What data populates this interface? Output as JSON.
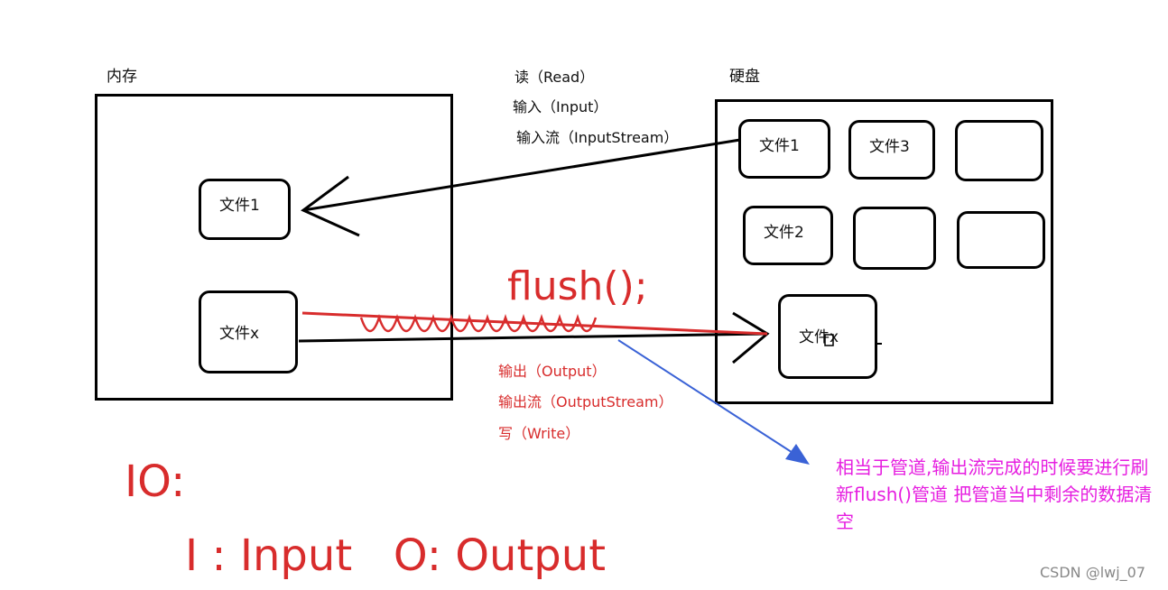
{
  "memory": {
    "title": "内存"
  },
  "disk": {
    "title": "硬盘"
  },
  "mem_files": {
    "file1": "文件1",
    "filex": "文件x"
  },
  "disk_files": {
    "file1": "文件1",
    "file3": "文件3",
    "file2": "文件2",
    "filex": "文件x"
  },
  "read_labels": {
    "read": "读（Read）",
    "input": "输入（Input）",
    "input_stream": "输入流（InputStream）"
  },
  "write_labels": {
    "output": "输出（Output）",
    "output_stream": "输出流（OutputStream）",
    "write": "写（Write）"
  },
  "flush_label": "flush();",
  "io": {
    "title": "IO:",
    "meaning": "I : Input   O: Output"
  },
  "note": "相当于管道,输出流完成的时候要进行刷新flush()管道 把管道当中剩余的数据清空",
  "watermark": "CSDN @lwj_07",
  "colors": {
    "red": "#d82c2c",
    "magenta": "#e61ee0",
    "blue": "#3a62d6"
  }
}
